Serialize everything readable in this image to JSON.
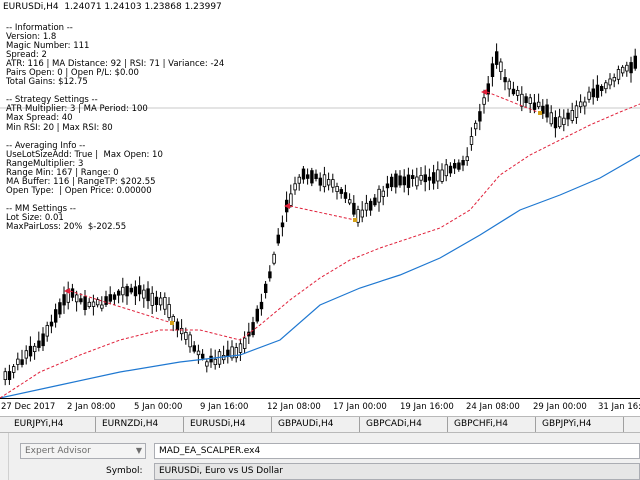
{
  "chart": {
    "ohlc_header": "EURUSDi,H4  1.24071 1.24103 1.23868 1.23997",
    "info_lines": [
      "-- Information --",
      "Version: 1.8",
      "Magic Number: 111",
      "Spread: 2",
      "ATR: 116 | MA Distance: 92 | RSI: 71 | Variance: -24",
      "Pairs Open: 0 | Open P/L: $0.00",
      "Total Gains: $12.75",
      "",
      "-- Strategy Settings --",
      "ATR Multiplier: 3 | MA Period: 100",
      "Max Spread: 40",
      "Min RSI: 20 | Max RSI: 80",
      "",
      "-- Averaging Info --",
      "UseLotSizeAdd: True |  Max Open: 10",
      "RangeMultiplier: 3",
      "Range Min: 167 | Range: 0",
      "MA Buffer: 116 | RangeTP: $202.55",
      "Open Type:  | Open Price: 0.00000",
      "",
      "-- MM Settings --",
      "Lot Size: 0.01",
      "MaxPairLoss: 20%  $-202.55"
    ],
    "x_labels": [
      "27 Dec 2017",
      "2 Jan 08:00",
      "5 Jan 00:00",
      "9 Jan 16:00",
      "12 Jan 08:00",
      "17 Jan 00:00",
      "19 Jan 16:00",
      "24 Jan 08:00",
      "29 Jan 00:00",
      "31 Jan 16:00"
    ],
    "colors": {
      "candle": "#000000",
      "ma_slow": "#1f78d1",
      "ma_dashed": "#e0203a",
      "arrow": "#e0203a",
      "marker": "#d4a017"
    }
  },
  "tabs": [
    "EURJPYi,H4",
    "EURNZDi,H4",
    "EURUSDi,H4",
    "GBPAUDi,H4",
    "GBPCADi,H4",
    "GBPCHFi,H4",
    "GBPJPYi,H4"
  ],
  "panel": {
    "type_select": "Expert Advisor",
    "ea_file": "MAD_EA_SCALPER.ex4",
    "symbol_label": "Symbol:",
    "symbol_value": "EURUSDi, Euro vs US Dollar"
  }
}
